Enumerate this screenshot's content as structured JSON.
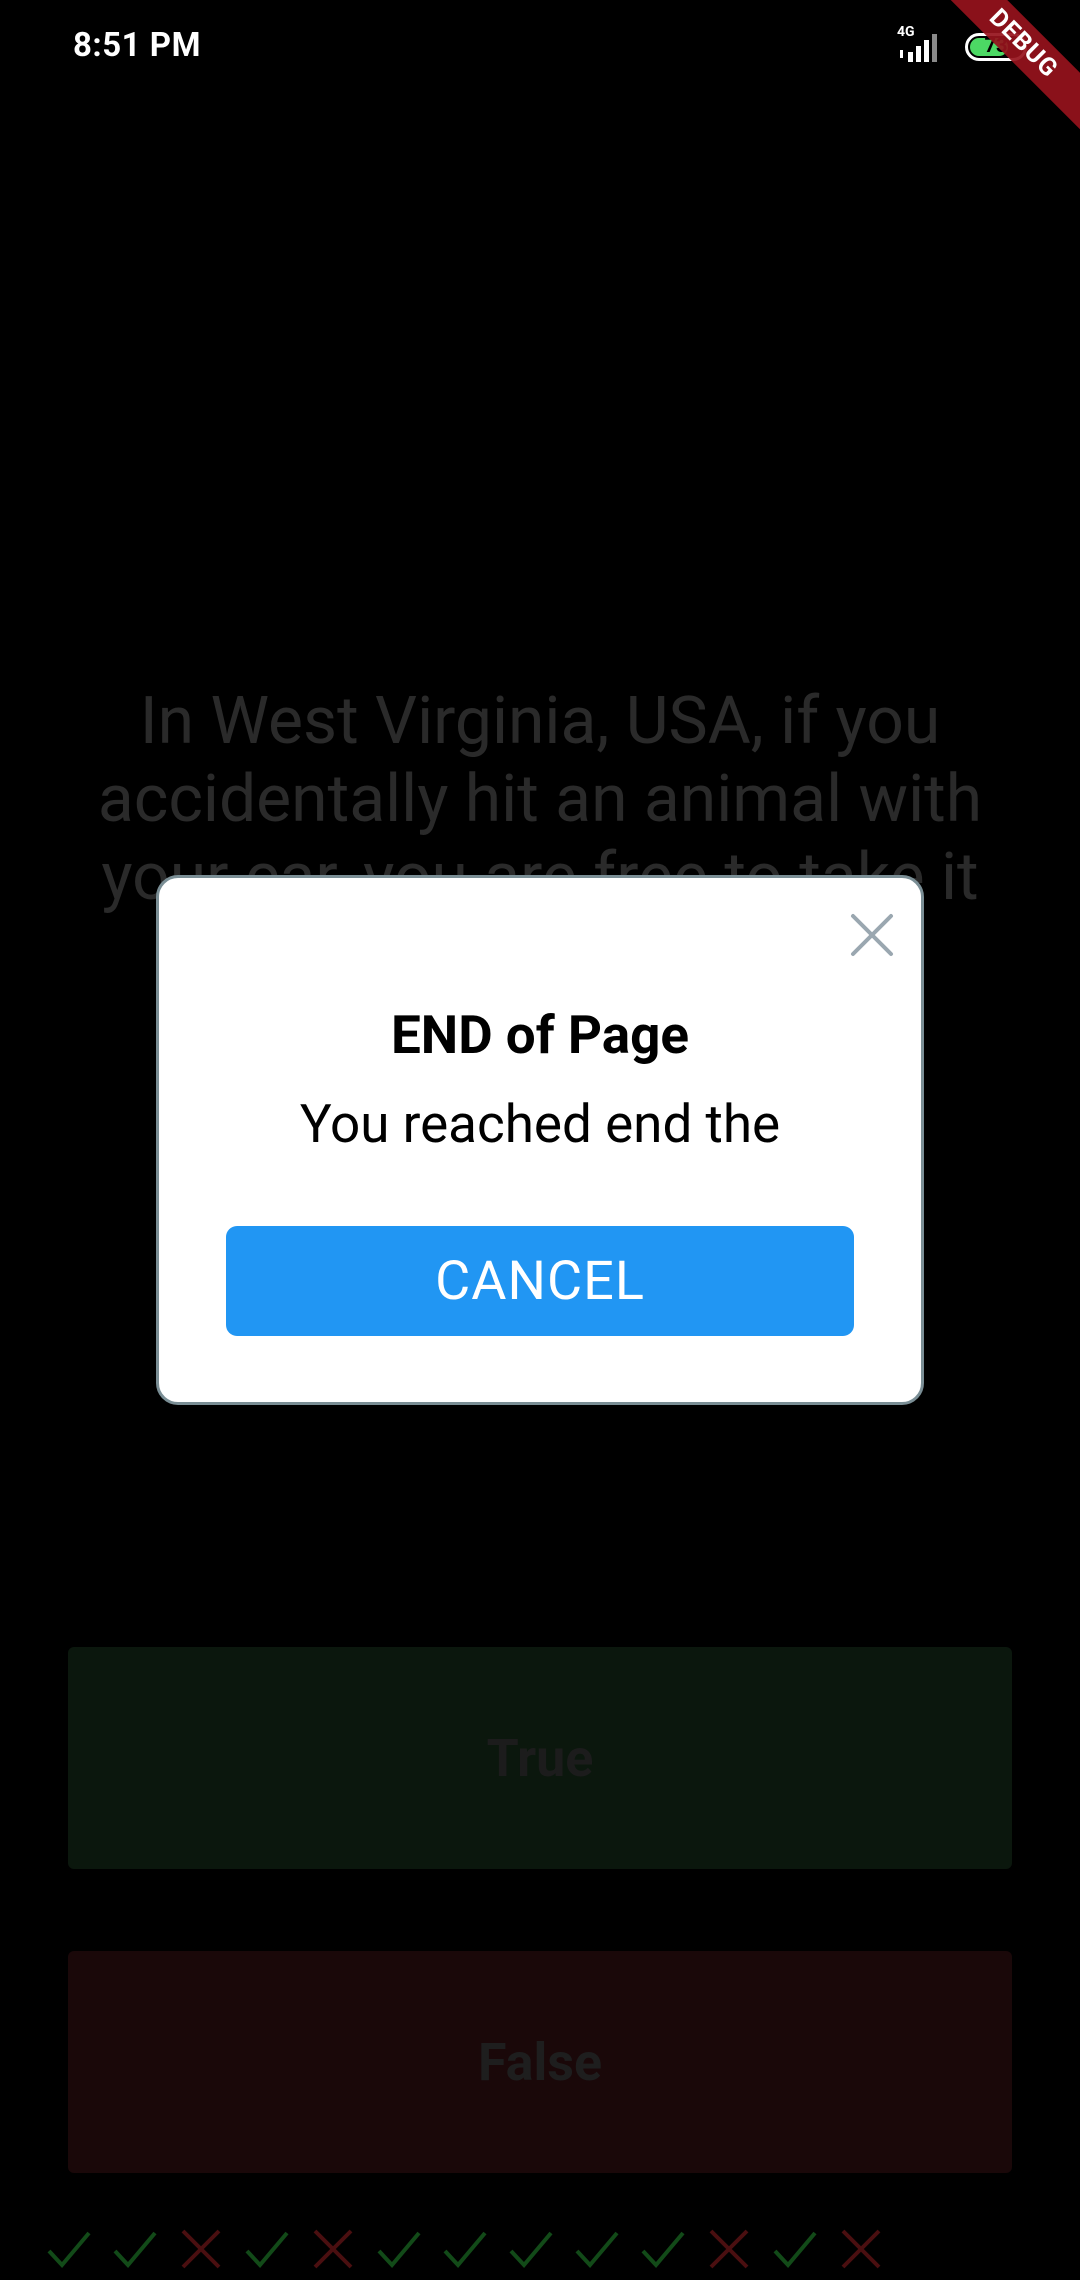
{
  "status_bar": {
    "time": "8:51 PM",
    "network": "4G",
    "battery": "73",
    "battery_level": 0.73,
    "debug_banner": "DEBUG"
  },
  "quiz": {
    "question": "In West Virginia, USA, if you accidentally hit an animal with your car, you are free to take it",
    "true_label": "True",
    "false_label": "False",
    "score_marks": [
      "correct",
      "correct",
      "wrong",
      "correct",
      "wrong",
      "correct",
      "correct",
      "correct",
      "correct",
      "correct",
      "wrong",
      "correct",
      "wrong"
    ]
  },
  "dialog": {
    "title": "END of Page",
    "message": "You reached end the",
    "cancel_label": "CANCEL",
    "close_icon": "close-icon"
  },
  "colors": {
    "dialog_button": "#2196f3",
    "correct_mark": "#124a18",
    "wrong_mark": "#4a0f10",
    "true_button_bg": "#0b170d",
    "false_button_bg": "#1a0809"
  }
}
